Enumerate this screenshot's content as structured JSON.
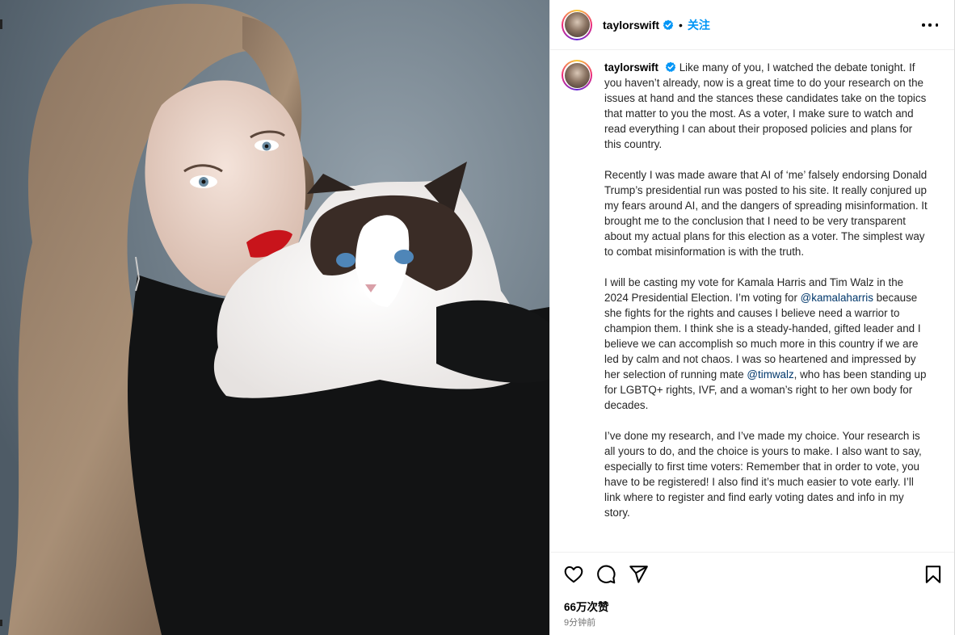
{
  "post": {
    "username": "taylorswift",
    "dot": "•",
    "follow_label": "关注",
    "caption_paragraphs": [
      "Recently I was made aware that AI of ‘me’ falsely endorsing Donald Trump’s presidential run was posted to his site. It really conjured up my fears around AI, and the dangers of spreading misinformation. It brought me to the conclusion that I need to be very transparent about my actual plans for this election as a voter. The simplest way to combat misinformation is with the truth.",
      "I’ve done my research, and I’ve made my choice. Your research is all yours to do, and the choice is yours to make. I also want to say, especially to first time voters: Remember that in order to vote, you have to be registered! I also find it’s much easier to vote early. I’ll link where to register and find early voting dates and info in my story."
    ],
    "caption_first": "Like many of you, I watched the debate tonight. If you haven’t already, now is a great time to do your research on the issues at hand and the stances these candidates take on the topics that matter to you the most. As a voter, I make sure to watch and read everything I can about their proposed policies and plans for this country.",
    "caption_third": {
      "part1": "I will be casting my vote for Kamala Harris and Tim Walz in the 2024 Presidential Election. I’m voting for ",
      "mention1": "@kamalaharris",
      "part2": " because she fights for the rights and causes I believe need a warrior to champion them. I think she is a steady-handed, gifted leader and I believe we can accomplish so much more in this country if we are led by calm and not chaos. I was so heartened and impressed by her selection of running mate ",
      "mention2": "@timwalz",
      "part3": ", who has been standing up for LGBTQ+ rights, IVF, and a woman’s right to her own body for decades."
    },
    "likes": "66万次赞",
    "time_ago": "9分钟前"
  },
  "icons": {
    "like": "heart-icon",
    "comment": "comment-icon",
    "share": "share-icon",
    "save": "bookmark-icon",
    "more": "more-options-icon",
    "verified": "verified-badge-icon"
  },
  "colors": {
    "follow": "#0095f6",
    "verified": "#0095f6",
    "mention": "#00376b",
    "muted": "#737373"
  }
}
